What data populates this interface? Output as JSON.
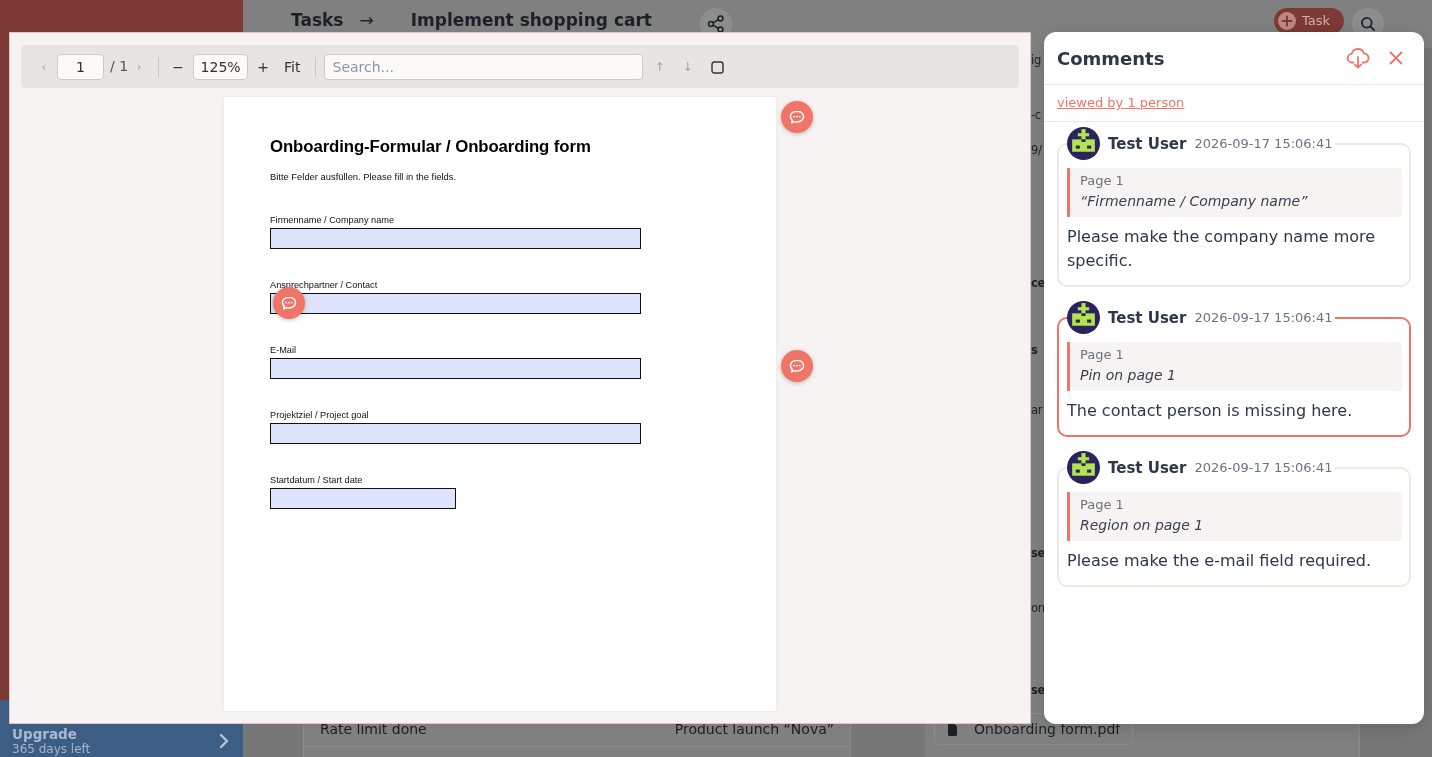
{
  "background": {
    "sidebar": {
      "upgrade_title": "Upgrade",
      "upgrade_subtitle": "365 days left"
    },
    "header": {
      "crumbs": [
        "Tasks",
        "Implement shopping cart"
      ],
      "separator": "→",
      "add_button": "Task"
    },
    "detail_fragments": [
      {
        "text": "ig",
        "bold": false
      },
      {
        "text": "-c",
        "bold": false
      },
      {
        "text": "9/",
        "bold": false
      },
      {
        "text": "ce",
        "bold": true
      },
      {
        "text": "s",
        "bold": true
      },
      {
        "text": "ar",
        "bold": false
      },
      {
        "text": "se",
        "bold": true
      },
      {
        "text": "on",
        "bold": false
      },
      {
        "text": "se",
        "bold": true
      }
    ],
    "attachment": "Onboarding form.pdf",
    "table_rows": [
      {
        "cells": [
          "Rate limit done",
          "Product launch “Nova”"
        ]
      }
    ]
  },
  "viewer": {
    "toolbar": [
      {
        "kind": "button",
        "label": "‹",
        "disabled": true
      },
      {
        "kind": "page_input",
        "value": "1"
      },
      {
        "kind": "page_count",
        "label": "/ 1"
      },
      {
        "kind": "button",
        "label": "›",
        "disabled": true
      },
      {
        "kind": "divider"
      },
      {
        "kind": "button",
        "label": "−",
        "disabled": false
      },
      {
        "kind": "zoom_input",
        "value": "125%"
      },
      {
        "kind": "button",
        "label": "+",
        "disabled": false
      },
      {
        "kind": "button",
        "label": "Fit",
        "disabled": false
      },
      {
        "kind": "divider"
      },
      {
        "kind": "search",
        "placeholder": "Search..."
      },
      {
        "kind": "button",
        "label": "↑",
        "disabled": true
      },
      {
        "kind": "button",
        "label": "↓",
        "disabled": true
      },
      {
        "kind": "icon_button",
        "disabled": false
      }
    ],
    "document": {
      "title": "Onboarding-Formular / Onboarding form",
      "subtitle": "Bitte Felder ausfüllen. Please fill in the fields.",
      "pin_in_margin": true,
      "fields": [
        {
          "label": "Firmenname / Company name",
          "kind": "text",
          "pin_on_field": false,
          "pin_in_margin": false
        },
        {
          "label": "Ansprechpartner / Contact",
          "kind": "text",
          "pin_on_field": true,
          "pin_in_margin": false
        },
        {
          "label": "E-Mail",
          "kind": "text",
          "pin_on_field": false,
          "pin_in_margin": true
        },
        {
          "label": "Projektziel / Project goal",
          "kind": "text",
          "pin_on_field": false,
          "pin_in_margin": false
        },
        {
          "label": "Startdatum / Start date",
          "kind": "date",
          "pin_on_field": false,
          "pin_in_margin": false
        }
      ]
    }
  },
  "comments": {
    "title": "Comments",
    "viewed_by": "viewed by 1 person",
    "items": [
      {
        "author": "Test User",
        "time": "2026-09-17 15:06:41",
        "page": "Page 1",
        "anchor": "“Firmenname / Company name”",
        "text": "Please make the company name more specific.",
        "selected": false
      },
      {
        "author": "Test User",
        "time": "2026-09-17 15:06:41",
        "page": "Page 1",
        "anchor": "Pin on page 1",
        "text": "The contact person is missing here.",
        "selected": true
      },
      {
        "author": "Test User",
        "time": "2026-09-17 15:06:41",
        "page": "Page 1",
        "anchor": "Region on page 1",
        "text": "Please make the e-mail field required.",
        "selected": false
      }
    ]
  }
}
